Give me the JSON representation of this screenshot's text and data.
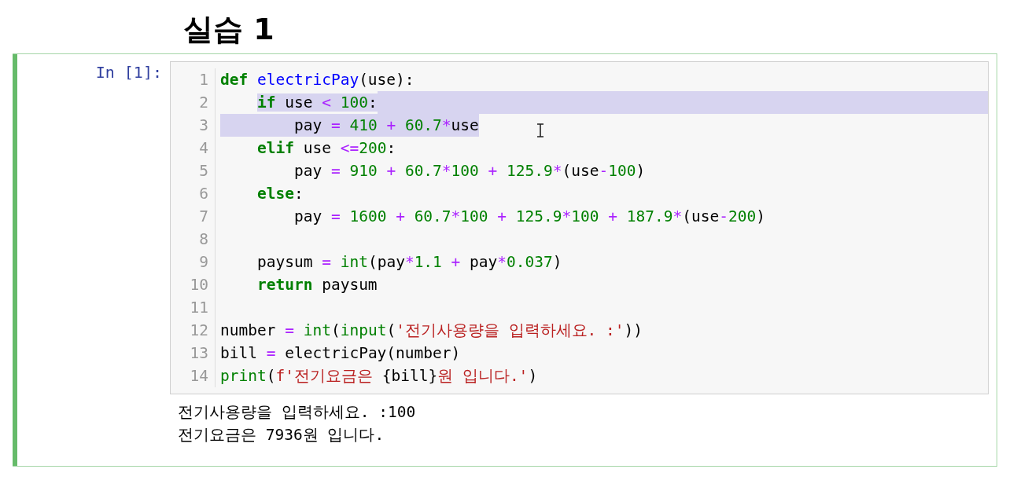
{
  "heading": "실습 1",
  "cell": {
    "prompt": "In [1]:",
    "lines": [
      {
        "number": "1",
        "selected": false,
        "selection_to_edge": false,
        "tokens": [
          {
            "kind": "keyword",
            "text": "def"
          },
          {
            "kind": "function",
            "text": " electricPay"
          },
          {
            "kind": "plain",
            "text": "(use):"
          }
        ]
      },
      {
        "number": "2",
        "selected": true,
        "selection_to_edge": true,
        "tokens": [
          {
            "kind": "keyword",
            "text": "    if"
          },
          {
            "kind": "plain",
            "text": " use"
          },
          {
            "kind": "operator",
            "text": " <"
          },
          {
            "kind": "number",
            "text": " 100"
          },
          {
            "kind": "plain",
            "text": ":"
          }
        ]
      },
      {
        "number": "3",
        "selected": true,
        "selection_to_edge": false,
        "tokens": [
          {
            "kind": "plain",
            "text": "        pay"
          },
          {
            "kind": "operator",
            "text": " ="
          },
          {
            "kind": "number",
            "text": " 410"
          },
          {
            "kind": "operator",
            "text": " +"
          },
          {
            "kind": "number",
            "text": " 60.7"
          },
          {
            "kind": "operator",
            "text": "*"
          },
          {
            "kind": "plain",
            "text": "use"
          }
        ]
      },
      {
        "number": "4",
        "selected": false,
        "selection_to_edge": false,
        "tokens": [
          {
            "kind": "keyword",
            "text": "    elif"
          },
          {
            "kind": "plain",
            "text": " use"
          },
          {
            "kind": "operator",
            "text": " <="
          },
          {
            "kind": "number",
            "text": "200"
          },
          {
            "kind": "plain",
            "text": ":"
          }
        ]
      },
      {
        "number": "5",
        "selected": false,
        "selection_to_edge": false,
        "tokens": [
          {
            "kind": "plain",
            "text": "        pay"
          },
          {
            "kind": "operator",
            "text": " ="
          },
          {
            "kind": "number",
            "text": " 910"
          },
          {
            "kind": "operator",
            "text": " +"
          },
          {
            "kind": "number",
            "text": " 60.7"
          },
          {
            "kind": "operator",
            "text": "*"
          },
          {
            "kind": "number",
            "text": "100"
          },
          {
            "kind": "operator",
            "text": " +"
          },
          {
            "kind": "number",
            "text": " 125.9"
          },
          {
            "kind": "operator",
            "text": "*"
          },
          {
            "kind": "plain",
            "text": "(use"
          },
          {
            "kind": "operator",
            "text": "-"
          },
          {
            "kind": "number",
            "text": "100"
          },
          {
            "kind": "plain",
            "text": ")"
          }
        ]
      },
      {
        "number": "6",
        "selected": false,
        "selection_to_edge": false,
        "tokens": [
          {
            "kind": "keyword",
            "text": "    else"
          },
          {
            "kind": "plain",
            "text": ":"
          }
        ]
      },
      {
        "number": "7",
        "selected": false,
        "selection_to_edge": false,
        "tokens": [
          {
            "kind": "plain",
            "text": "        pay"
          },
          {
            "kind": "operator",
            "text": " ="
          },
          {
            "kind": "number",
            "text": " 1600"
          },
          {
            "kind": "operator",
            "text": " +"
          },
          {
            "kind": "number",
            "text": " 60.7"
          },
          {
            "kind": "operator",
            "text": "*"
          },
          {
            "kind": "number",
            "text": "100"
          },
          {
            "kind": "operator",
            "text": " +"
          },
          {
            "kind": "number",
            "text": " 125.9"
          },
          {
            "kind": "operator",
            "text": "*"
          },
          {
            "kind": "number",
            "text": "100"
          },
          {
            "kind": "operator",
            "text": " +"
          },
          {
            "kind": "number",
            "text": " 187.9"
          },
          {
            "kind": "operator",
            "text": "*"
          },
          {
            "kind": "plain",
            "text": "(use"
          },
          {
            "kind": "operator",
            "text": "-"
          },
          {
            "kind": "number",
            "text": "200"
          },
          {
            "kind": "plain",
            "text": ")"
          }
        ]
      },
      {
        "number": "8",
        "selected": false,
        "selection_to_edge": false
      },
      {
        "number": "9",
        "selected": false,
        "selection_to_edge": false,
        "tokens": [
          {
            "kind": "plain",
            "text": "    paysum"
          },
          {
            "kind": "operator",
            "text": " ="
          },
          {
            "kind": "builtin",
            "text": " int"
          },
          {
            "kind": "plain",
            "text": "(pay"
          },
          {
            "kind": "operator",
            "text": "*"
          },
          {
            "kind": "number",
            "text": "1.1"
          },
          {
            "kind": "operator",
            "text": " +"
          },
          {
            "kind": "plain",
            "text": " pay"
          },
          {
            "kind": "operator",
            "text": "*"
          },
          {
            "kind": "number",
            "text": "0.037"
          },
          {
            "kind": "plain",
            "text": ")"
          }
        ]
      },
      {
        "number": "10",
        "selected": false,
        "selection_to_edge": false,
        "tokens": [
          {
            "kind": "keyword",
            "text": "    return"
          },
          {
            "kind": "plain",
            "text": " paysum"
          }
        ]
      },
      {
        "number": "11",
        "selected": false,
        "selection_to_edge": false
      },
      {
        "number": "12",
        "selected": false,
        "selection_to_edge": false,
        "tokens": [
          {
            "kind": "plain",
            "text": "number"
          },
          {
            "kind": "operator",
            "text": " ="
          },
          {
            "kind": "builtin",
            "text": " int"
          },
          {
            "kind": "plain",
            "text": "("
          },
          {
            "kind": "builtin",
            "text": "input"
          },
          {
            "kind": "plain",
            "text": "("
          },
          {
            "kind": "string",
            "text": "'전기사용량을 입력하세요. :'"
          },
          {
            "kind": "plain",
            "text": "))"
          }
        ]
      },
      {
        "number": "13",
        "selected": false,
        "selection_to_edge": false,
        "tokens": [
          {
            "kind": "plain",
            "text": "bill"
          },
          {
            "kind": "operator",
            "text": " ="
          },
          {
            "kind": "plain",
            "text": " electricPay(number)"
          }
        ]
      },
      {
        "number": "14",
        "selected": false,
        "selection_to_edge": false,
        "tokens": [
          {
            "kind": "builtin",
            "text": "print"
          },
          {
            "kind": "plain",
            "text": "("
          },
          {
            "kind": "string",
            "text": "f'전기요금은"
          },
          {
            "kind": "plain",
            "text": " {bill}"
          },
          {
            "kind": "string",
            "text": "원 입니다.'"
          },
          {
            "kind": "plain",
            "text": ")"
          }
        ]
      }
    ],
    "output": [
      "전기사용량을 입력하세요. :100",
      "전기요금은 7936원 입니다."
    ]
  }
}
